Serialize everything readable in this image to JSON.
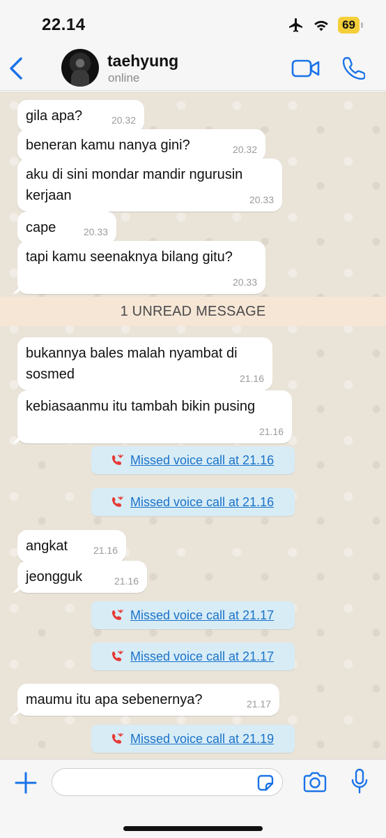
{
  "status_bar": {
    "time": "22.14",
    "battery": "69",
    "icons": [
      "airplane-icon",
      "wifi-icon",
      "battery-icon"
    ]
  },
  "header": {
    "contact_name": "taehyung",
    "contact_status": "online",
    "icons": [
      "back-chevron-icon",
      "video-call-icon",
      "phone-icon"
    ]
  },
  "messages": [
    {
      "text": "gila apa?",
      "time": "20.32"
    },
    {
      "text": "beneran kamu nanya gini?",
      "time": "20.32"
    },
    {
      "text": "aku di sini mondar mandir ngurusin kerjaan",
      "time": "20.33"
    },
    {
      "text": "cape",
      "time": "20.33"
    },
    {
      "text": "tapi kamu seenaknya bilang gitu?",
      "time": "20.33"
    },
    {
      "text": "bukannya bales malah nyambat di sosmed",
      "time": "21.16"
    },
    {
      "text": "kebiasaanmu itu tambah bikin pusing",
      "time": "21.16"
    },
    {
      "text": "angkat",
      "time": "21.16"
    },
    {
      "text": "jeongguk",
      "time": "21.16"
    },
    {
      "text": "maumu itu apa sebenernya?",
      "time": "21.17"
    }
  ],
  "unread_banner": "1 UNREAD MESSAGE",
  "missed_calls": [
    {
      "label": "Missed voice call at 21.16"
    },
    {
      "label": "Missed voice call at 21.16"
    },
    {
      "label": "Missed voice call at 21.17"
    },
    {
      "label": "Missed voice call at 21.17"
    },
    {
      "label": "Missed voice call at 21.19"
    }
  ],
  "input_bar": {
    "value": "",
    "icons": [
      "plus-icon",
      "sticker-icon",
      "camera-icon",
      "microphone-icon"
    ]
  },
  "colors": {
    "accent": "#1a73e8",
    "chat_background": "#e9e3d8",
    "unread_banner": "#f6e6d6",
    "missed_call_bubble": "#d8ecf6",
    "missed_call_icon": "#e53935",
    "battery": "#f4cf3a"
  }
}
